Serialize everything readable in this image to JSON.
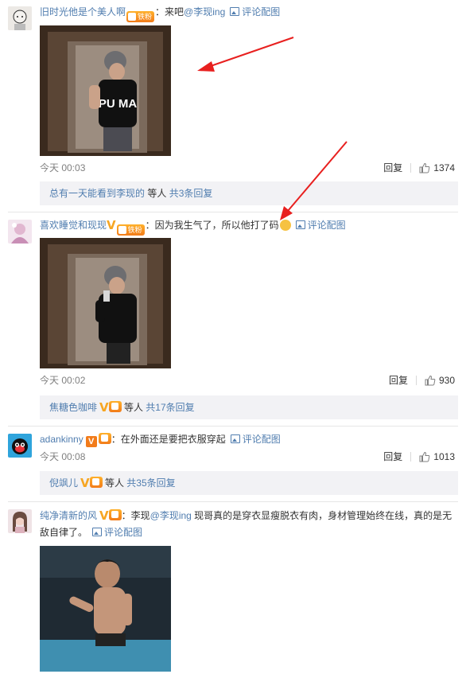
{
  "comments": [
    {
      "username": "旧时光他是个美人啊",
      "fan_badge": "铁粉",
      "text_prefix": "：来吧",
      "mention": "@李现ing",
      "peitu": "评论配图",
      "time": "今天 00:03",
      "reply": "回复",
      "likes": "1374",
      "sub": {
        "name": "总有一天能看到李现的",
        "text": " 等人 ",
        "count": "共3条回复"
      },
      "photo_text": "PU MA"
    },
    {
      "username": "喜欢睡觉和现现",
      "fan_badge": "铁粉",
      "text": "：因为我生气了，所以他打了码",
      "peitu": "评论配图",
      "time": "今天 00:02",
      "reply": "回复",
      "likes": "930",
      "sub": {
        "name": "焦糖色咖啡",
        "text": " 等人 ",
        "count": "共17条回复"
      }
    },
    {
      "username": "adankinny",
      "text": "：在外面还是要把衣服穿起",
      "peitu": "评论配图",
      "time": "今天 00:08",
      "reply": "回复",
      "likes": "1013",
      "sub": {
        "name": "倪飒儿",
        "text": " 等人 ",
        "count": "共35条回复"
      }
    },
    {
      "username": "纯净清新的风",
      "text_prefix": "：李现",
      "mention": "@李现ing",
      "text_suffix": " 现哥真的是穿衣显瘦脱衣有肉，身材管理始终在线，真的是无敌自律了。",
      "peitu": "评论配图"
    }
  ],
  "colors": {
    "link": "#507daf",
    "sub_bg": "#f2f2f5",
    "badge": "#f6a623",
    "arrow": "#e8201f"
  }
}
